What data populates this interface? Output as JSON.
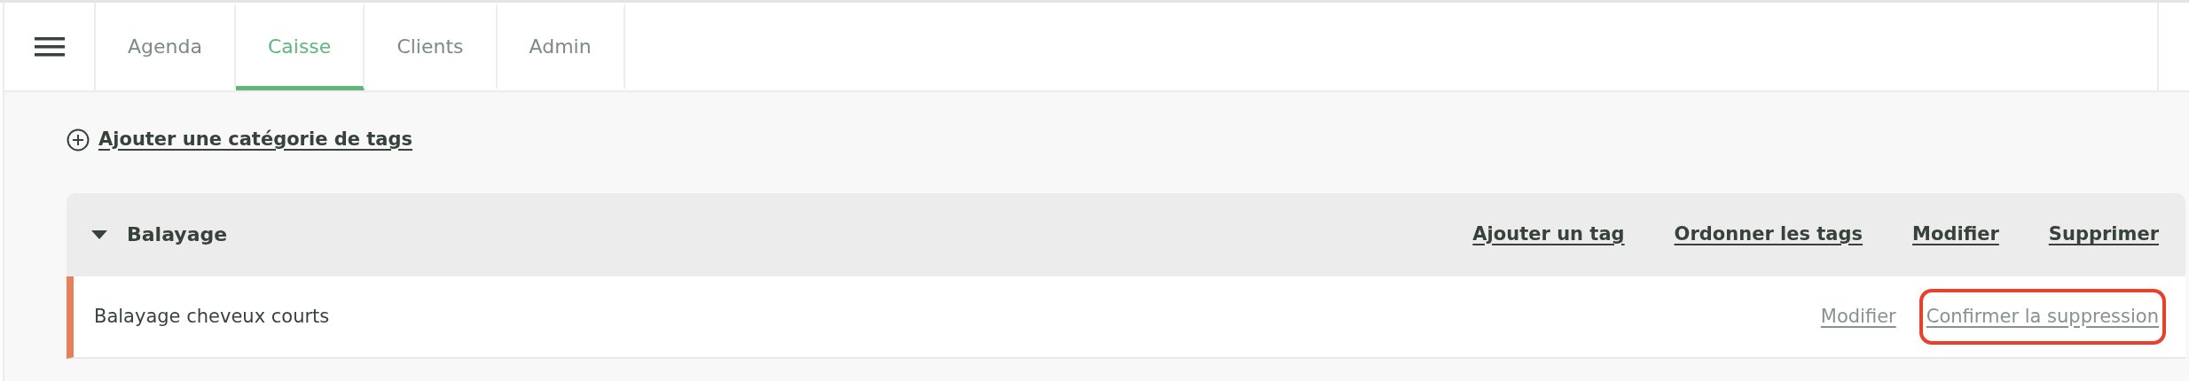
{
  "tabs": [
    {
      "label": "Agenda",
      "selected": false
    },
    {
      "label": "Caisse",
      "selected": true
    },
    {
      "label": "Clients",
      "selected": false
    },
    {
      "label": "Admin",
      "selected": false
    }
  ],
  "add_category_link": "Ajouter une catégorie de tags",
  "category": {
    "name": "Balayage",
    "expanded": true,
    "actions": [
      "Ajouter un tag",
      "Ordonner les tags",
      "Modifier",
      "Supprimer"
    ],
    "tags": [
      {
        "name": "Balayage cheveux courts",
        "color": "#e5805a",
        "actions": [
          {
            "label": "Modifier",
            "highlighted": false
          },
          {
            "label": "Confirmer la suppression",
            "highlighted": true
          }
        ]
      }
    ]
  }
}
